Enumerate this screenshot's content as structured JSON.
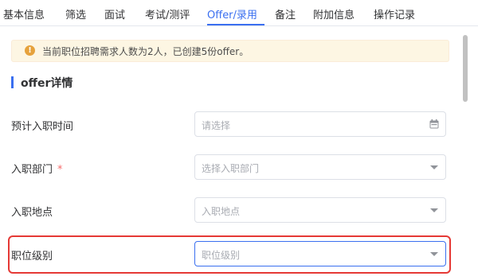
{
  "tabs": [
    {
      "label": "基本信息",
      "active": false
    },
    {
      "label": "筛选",
      "active": false
    },
    {
      "label": "面试",
      "active": false
    },
    {
      "label": "考试/测评",
      "active": false
    },
    {
      "label": "Offer/录用",
      "active": true
    },
    {
      "label": "备注",
      "active": false
    },
    {
      "label": "附加信息",
      "active": false
    },
    {
      "label": "操作记录",
      "active": false
    }
  ],
  "alert": {
    "icon": "warning-icon",
    "text": "当前职位招聘需求人数为2人，已创建5份offer。"
  },
  "section": {
    "title": "offer详情"
  },
  "form": {
    "fields": [
      {
        "label": "预计入职时间",
        "placeholder": "请选择",
        "icon": "calendar-icon",
        "required": false
      },
      {
        "label": "入职部门",
        "placeholder": "选择入职部门",
        "icon": "chevron-down-icon",
        "required": true,
        "required_mark": "*"
      },
      {
        "label": "入职地点",
        "placeholder": "入职地点",
        "icon": "chevron-down-icon",
        "required": false
      },
      {
        "label": "职位级别",
        "placeholder": "职位级别",
        "icon": "chevron-down-icon",
        "required": false,
        "focused": true,
        "highlighted": true
      }
    ]
  },
  "colors": {
    "accent": "#3a6ff0",
    "highlight": "#e53935",
    "warning": "#e6a23c",
    "required": "#f56c6c"
  }
}
